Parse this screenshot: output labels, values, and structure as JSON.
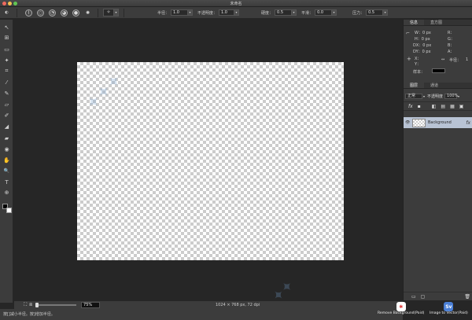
{
  "window": {
    "title": "未命名"
  },
  "options": {
    "brush_glyph": "✧",
    "radius_label": "半径：",
    "radius_value": "1.0",
    "opacity_label": "不透明度：",
    "opacity_value": "1.0",
    "hardness_label": "硬度：",
    "hardness_value": "0.5",
    "smooth_label": "平滑：",
    "smooth_value": "0.0",
    "pressure_label": "压力：",
    "pressure_value": "0.5",
    "dropdown_arrow": "▾"
  },
  "toolbar": {
    "icons": [
      "↖",
      "⊞",
      "▭",
      "✦",
      "⌗",
      "⁄",
      "✎",
      "▱",
      "✐",
      "◢",
      "▰",
      "◉",
      "✋",
      "🔍",
      "T",
      "⊕"
    ]
  },
  "info_panel": {
    "tabs": [
      "信息",
      "直方图"
    ],
    "w": "W：0 px",
    "h": "H：0 px",
    "dx": "DX：0 px",
    "dy": "DY：0 px",
    "r": "R：",
    "g": "G：",
    "b": "B：",
    "a": "A：",
    "x": "X：",
    "y": "Y：",
    "radius": "半径：",
    "radius_value": "1",
    "sample": "样本："
  },
  "layers_panel": {
    "tabs": [
      "图层",
      "通道"
    ],
    "blend_mode": "正常",
    "opacity_label": "不透明度",
    "opacity_value": "100%",
    "fx": "fx",
    "layer_name": "Background"
  },
  "status": {
    "zoom": "75%",
    "canvas_info": "1024 × 768 px, 72 dpi",
    "hint": "按[]减小半径。按]增加半径。"
  },
  "promos": {
    "remove_bg": "Remove Background(Paid)",
    "img_to_vector": "Image to Vector(Paid)",
    "sv": "Sv"
  },
  "colors": {
    "accent_selected": "#b8c3d4",
    "panel": "#3c3c3c",
    "workspace": "#262626"
  }
}
